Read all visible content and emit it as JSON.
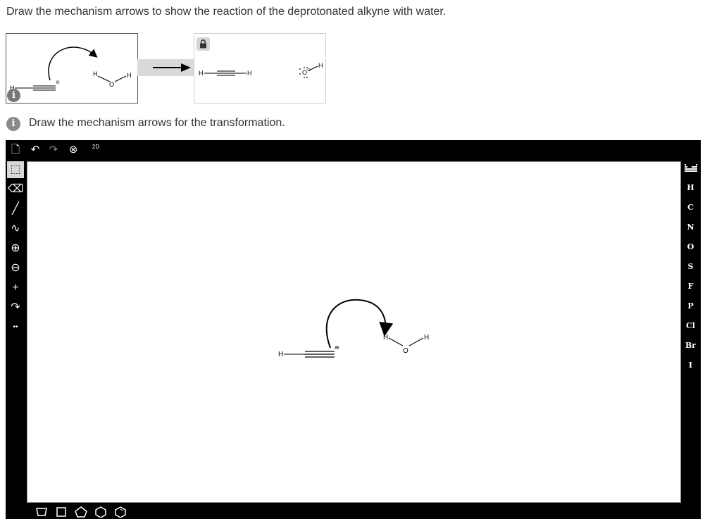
{
  "question": "Draw the mechanism arrows to show the reaction of the deprotonated alkyne with water.",
  "instruction": "Draw the mechanism arrows for the transformation.",
  "info_icon_glyph": "i",
  "lock_icon": "lock-icon",
  "atoms": {
    "H": "H",
    "O": "O",
    "charge": "⊖"
  },
  "editor": {
    "top_toolbar": {
      "new_icon": "🗋",
      "undo_icon": "↶",
      "redo_icon": "↷",
      "zoom_icon": "⊗",
      "template_label": "2D"
    },
    "left_tools": [
      {
        "name": "select-tool",
        "glyph": "⬚"
      },
      {
        "name": "eraser-tool",
        "glyph": "⌫"
      },
      {
        "name": "bond-tool",
        "glyph": "╱"
      },
      {
        "name": "chain-tool",
        "glyph": "∿"
      },
      {
        "name": "positive-charge-tool",
        "glyph": "⊕"
      },
      {
        "name": "negative-charge-tool",
        "glyph": "⊖"
      },
      {
        "name": "electron-push-tool",
        "glyph": "+"
      },
      {
        "name": "curved-arrow-tool",
        "glyph": "↷"
      },
      {
        "name": "lone-pair-tool",
        "glyph": "••"
      }
    ],
    "elements": [
      "H",
      "C",
      "N",
      "O",
      "S",
      "F",
      "P",
      "Cl",
      "Br",
      "I"
    ],
    "periodic_table_icon": "periodic-table-icon",
    "shapes": [
      "cyclopropane",
      "cyclobutane",
      "cyclopentane",
      "cyclohexane",
      "benzene"
    ]
  }
}
